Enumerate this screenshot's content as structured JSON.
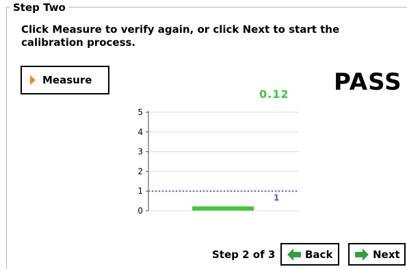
{
  "group": {
    "title": "Step Two"
  },
  "instructions": "Click Measure to verify again, or click Next to start the calibration process.",
  "measure_button": {
    "label": "Measure",
    "icon": "play-icon",
    "icon_color": "#f28a1a"
  },
  "result": {
    "status": "PASS",
    "reading": "0.12",
    "reading_color": "#3ec83a"
  },
  "chart_data": {
    "type": "bar",
    "orientation": "horizontal-level",
    "ylim": [
      0,
      5
    ],
    "yticks": [
      "0",
      "1",
      "2",
      "3",
      "4",
      "5"
    ],
    "grid": true,
    "series": [
      {
        "value": 0.12,
        "color": "#3ec83a"
      }
    ],
    "threshold": {
      "value": 1,
      "label": "1",
      "color": "#3a5fd9",
      "style": "dotted"
    }
  },
  "footer": {
    "step_info": "Step 2 of 3",
    "back_label": "Back",
    "next_label": "Next",
    "arrow_color": "#2da43a"
  }
}
